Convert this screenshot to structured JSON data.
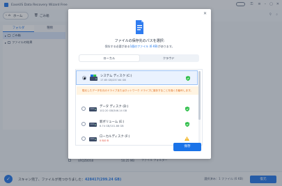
{
  "app": {
    "title": "EaseUS Data Recovery Wizard Free",
    "key_icon": "key-icon"
  },
  "toolbar": {
    "home_label": "ホーム",
    "trash_label": "ごみ箱"
  },
  "sidebar": {
    "tabs": [
      "フォルダ",
      "種類"
    ],
    "items": [
      {
        "label": "ごみ箱",
        "selected": true
      },
      {
        "label": "ファイルの結果",
        "selected": false
      }
    ]
  },
  "background_row": {
    "name": "$RQZBOS8",
    "size": "50.25 MB",
    "type": "ファイル フォルダー"
  },
  "status": {
    "prefix": "スキャン完了、ファイルが見つかりました：",
    "count": "428417(299.24 GB)",
    "selected": "選択済み：1 ファイル (6 KB)",
    "recover_label": "復元"
  },
  "dialog": {
    "title": "ファイルの保存先のパスを選択:",
    "subtitle_prefix": "保存する必要がある",
    "subtitle_highlight": "1個のファイル (6 KB)",
    "subtitle_suffix": "があります。",
    "tabs": [
      "ローカル",
      "クラウド"
    ],
    "active_tab": "ローカル",
    "warning": "復元したデータを元のドライブまたはネットワーク ドライブに保存することを強くお勧めします。",
    "save_label": "保存",
    "drives": [
      {
        "name": "システム ディスク (C:)",
        "capacity": "17.65 GB/237.64 GB",
        "status": "protected",
        "selected": true
      },
      {
        "name": "データ ディスク (D:)",
        "capacity": "102.20 GB/346.14 GB",
        "status": "protected",
        "selected": false
      },
      {
        "name": "新ボリューム (E:)",
        "capacity": "6.74 GB/101.86 GB",
        "status": "protected",
        "selected": false
      },
      {
        "name": "ローカルディスク (F:)",
        "capacity": "0 B/0 B",
        "status": "warning",
        "selected": false
      }
    ]
  },
  "colors": {
    "accent": "#1a73e8",
    "shield_green": "#2fbf4a",
    "warning_orange": "#e06a1b",
    "warning_yellow": "#f2b21b"
  }
}
